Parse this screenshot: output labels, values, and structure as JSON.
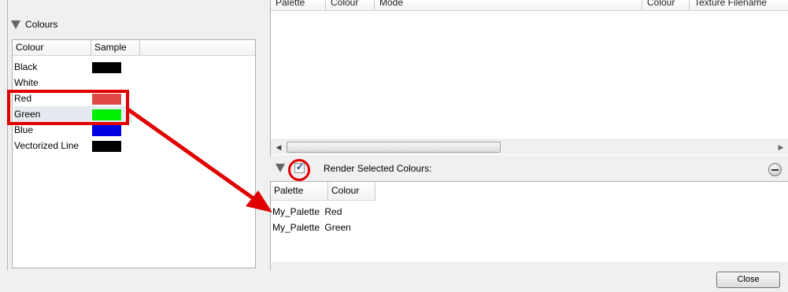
{
  "colours_panel": {
    "title": "Colours",
    "columns": [
      "Colour",
      "Sample"
    ],
    "rows": [
      {
        "name": "Black",
        "sample": "#000000"
      },
      {
        "name": "White",
        "sample": "#ffffff"
      },
      {
        "name": "Red",
        "sample": "#e04848"
      },
      {
        "name": "Green",
        "sample": "#00f000"
      },
      {
        "name": "Blue",
        "sample": "#0000e0"
      },
      {
        "name": "Vectorized Line",
        "sample": "#000000"
      }
    ]
  },
  "top_table": {
    "columns": [
      "Palette",
      "Colour",
      "Mode",
      "Colour",
      "Texture Filename"
    ]
  },
  "render_section": {
    "checkbox_checked": true,
    "label": "Render Selected Colours:",
    "columns": [
      "Palette",
      "Colour"
    ],
    "rows": [
      {
        "palette": "My_Palette",
        "colour": "Red"
      },
      {
        "palette": "My_Palette",
        "colour": "Green"
      }
    ]
  },
  "buttons": {
    "close": "Close"
  },
  "annotation": {
    "color": "#e00000"
  }
}
